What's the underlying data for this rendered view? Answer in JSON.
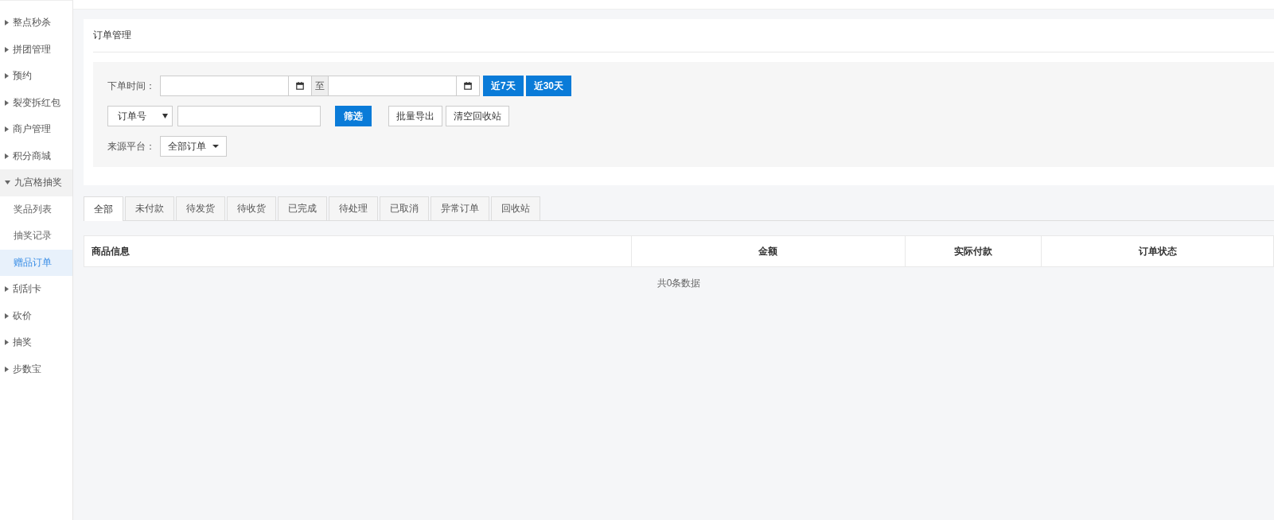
{
  "sidebar": {
    "items": [
      {
        "label": "整点秒杀",
        "expanded": false
      },
      {
        "label": "拼团管理",
        "expanded": false
      },
      {
        "label": "预约",
        "expanded": false
      },
      {
        "label": "裂变拆红包",
        "expanded": false
      },
      {
        "label": "商户管理",
        "expanded": false
      },
      {
        "label": "积分商城",
        "expanded": false
      },
      {
        "label": "九宫格抽奖",
        "expanded": true,
        "children": [
          {
            "label": "奖品列表",
            "selected": false
          },
          {
            "label": "抽奖记录",
            "selected": false
          },
          {
            "label": "赠品订单",
            "selected": true
          }
        ]
      },
      {
        "label": "刮刮卡",
        "expanded": false
      },
      {
        "label": "砍价",
        "expanded": false
      },
      {
        "label": "抽奖",
        "expanded": false
      },
      {
        "label": "步数宝",
        "expanded": false
      }
    ]
  },
  "panel": {
    "title": "订单管理"
  },
  "filters": {
    "date_label": "下单时间：",
    "date_separator": "至",
    "quick_buttons": [
      "近7天",
      "近30天"
    ],
    "search_type": "订单号",
    "filter_button": "筛选",
    "actions": [
      "批量导出",
      "清空回收站"
    ],
    "source_label": "来源平台：",
    "source_value": "全部订单"
  },
  "tabs": [
    {
      "label": "全部",
      "selected": true
    },
    {
      "label": "未付款",
      "selected": false
    },
    {
      "label": "待发货",
      "selected": false
    },
    {
      "label": "待收货",
      "selected": false
    },
    {
      "label": "已完成",
      "selected": false
    },
    {
      "label": "待处理",
      "selected": false
    },
    {
      "label": "已取消",
      "selected": false
    },
    {
      "label": "异常订单",
      "selected": false
    },
    {
      "label": "回收站",
      "selected": false
    }
  ],
  "table": {
    "columns": [
      "商品信息",
      "金额",
      "实际付款",
      "订单状态"
    ],
    "empty_text": "共0条数据"
  }
}
